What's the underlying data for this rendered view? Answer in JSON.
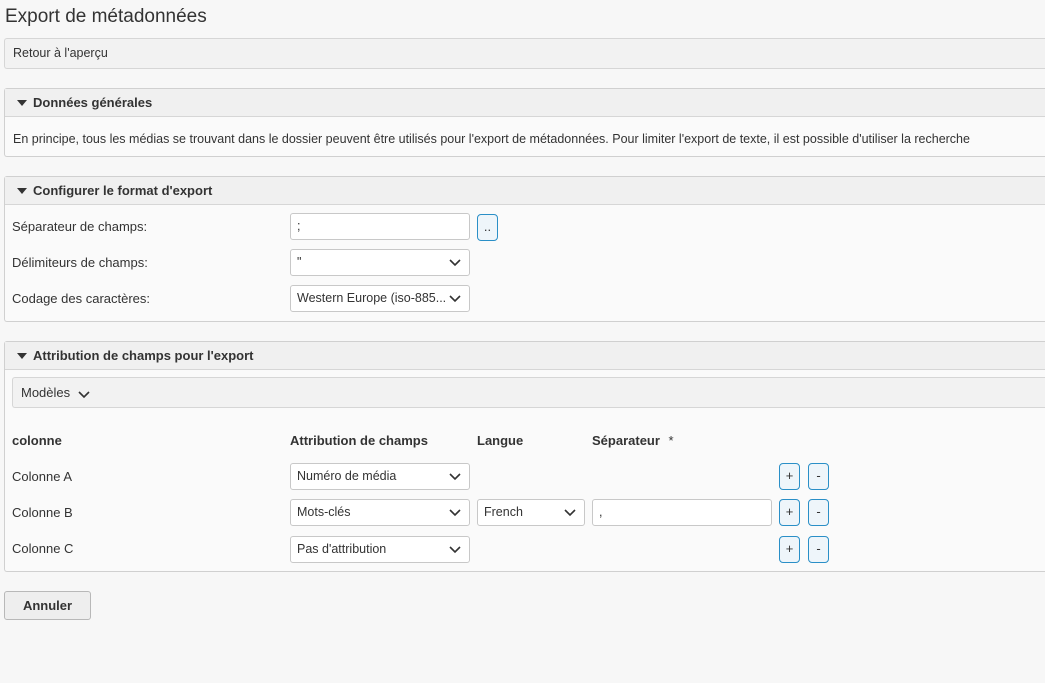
{
  "page": {
    "title": "Export de métadonnées"
  },
  "back": {
    "label": "Retour à l'aperçu"
  },
  "general": {
    "title": "Données générales",
    "text": "En principe, tous les médias se trouvant dans le dossier peuvent être utilisés pour l'export de métadonnées. Pour limiter l'export de texte, il est possible d'utiliser la recherche"
  },
  "format": {
    "title": "Configurer le format d'export",
    "field_separator": {
      "label": "Séparateur de champs:",
      "value": ";",
      "button": ".."
    },
    "field_delimiter": {
      "label": "Délimiteurs de champs:",
      "value": "\""
    },
    "encoding": {
      "label": "Codage des caractères:",
      "value": "Western Europe (iso-885..."
    }
  },
  "mapping": {
    "title": "Attribution de champs pour l'export",
    "models_label": "Modèles",
    "headers": {
      "column": "colonne",
      "attribution": "Attribution de champs",
      "language": "Langue",
      "separator": "Séparateur",
      "required": "*"
    },
    "rows": [
      {
        "name": "Colonne A",
        "attribution": "Numéro de média",
        "add": "+",
        "remove": "-"
      },
      {
        "name": "Colonne B",
        "attribution": "Mots-clés",
        "language": "French",
        "separator": ",",
        "add": "+",
        "remove": "-"
      },
      {
        "name": "Colonne C",
        "attribution": "Pas d'attribution",
        "add": "+",
        "remove": "-"
      }
    ]
  },
  "actions": {
    "cancel": "Annuler"
  }
}
